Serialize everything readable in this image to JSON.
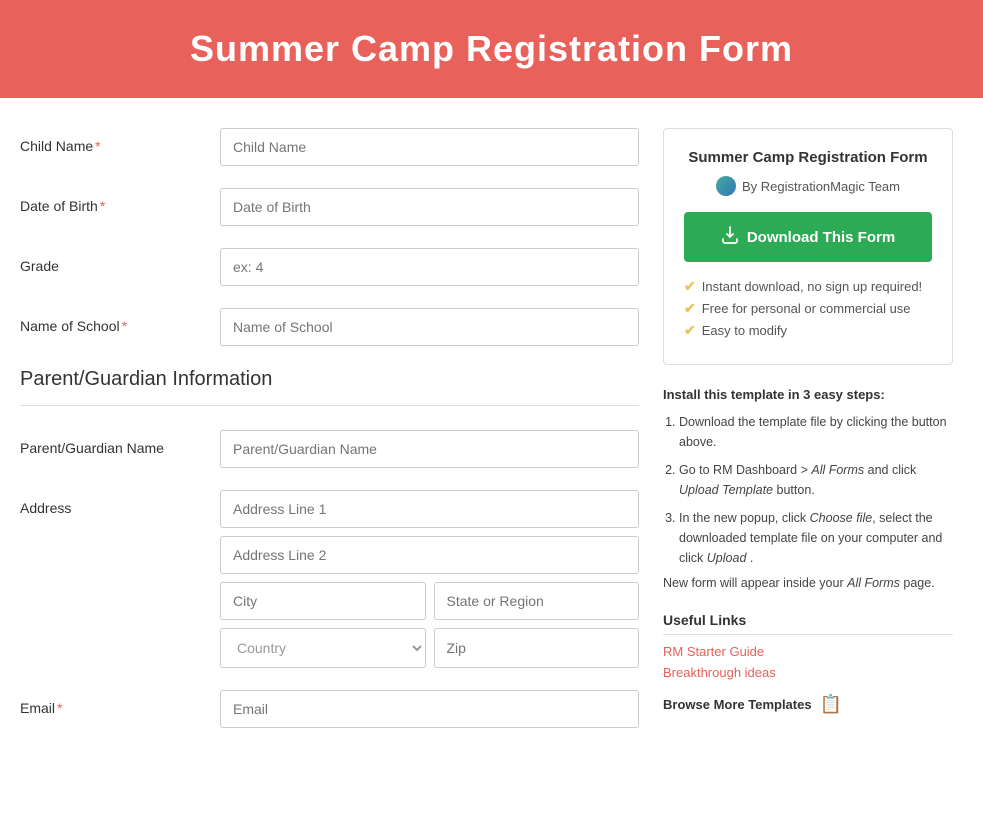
{
  "header": {
    "title": "Summer Camp Registration Form"
  },
  "form": {
    "fields": [
      {
        "label": "Child Name",
        "required": true,
        "placeholder": "Child Name",
        "type": "text",
        "name": "child-name"
      },
      {
        "label": "Date of Birth",
        "required": true,
        "placeholder": "Date of Birth",
        "type": "text",
        "name": "date-of-birth"
      },
      {
        "label": "Grade",
        "required": false,
        "placeholder": "ex: 4",
        "type": "text",
        "name": "grade"
      },
      {
        "label": "Name of School",
        "required": true,
        "placeholder": "Name of School",
        "type": "text",
        "name": "name-of-school"
      }
    ],
    "section_title": "Parent/Guardian Information",
    "parent_fields": [
      {
        "label": "Parent/Guardian Name",
        "required": false,
        "placeholder": "Parent/Guardian Name",
        "type": "text",
        "name": "guardian-name"
      }
    ],
    "address_label": "Address",
    "address_line1_placeholder": "Address Line 1",
    "address_line2_placeholder": "Address Line 2",
    "city_placeholder": "City",
    "state_placeholder": "State or Region",
    "country_placeholder": "Country",
    "zip_placeholder": "Zip",
    "email_label": "Email",
    "email_required": true,
    "email_placeholder": "Email"
  },
  "sidebar": {
    "card_title": "Summer Camp Registration Form",
    "author_label": "By RegistrationMagic Team",
    "download_button_label": "Download This Form",
    "features": [
      "Instant download, no sign up required!",
      "Free for personal or commercial use",
      "Easy to modify"
    ],
    "install_title": "Install this template in 3 easy steps:",
    "install_steps": [
      "Download the template file by clicking the button above.",
      "Go to RM Dashboard > All Forms and click Upload Template button.",
      "In the new popup, click  Choose file, select the downloaded template file on your computer and click  Upload ."
    ],
    "install_note": "New form will appear inside your All Forms page.",
    "useful_links_title": "Useful Links",
    "links": [
      {
        "label": "RM Starter Guide",
        "url": "#"
      },
      {
        "label": "Breakthrough ideas",
        "url": "#"
      }
    ],
    "browse_more_label": "Browse More Templates"
  }
}
